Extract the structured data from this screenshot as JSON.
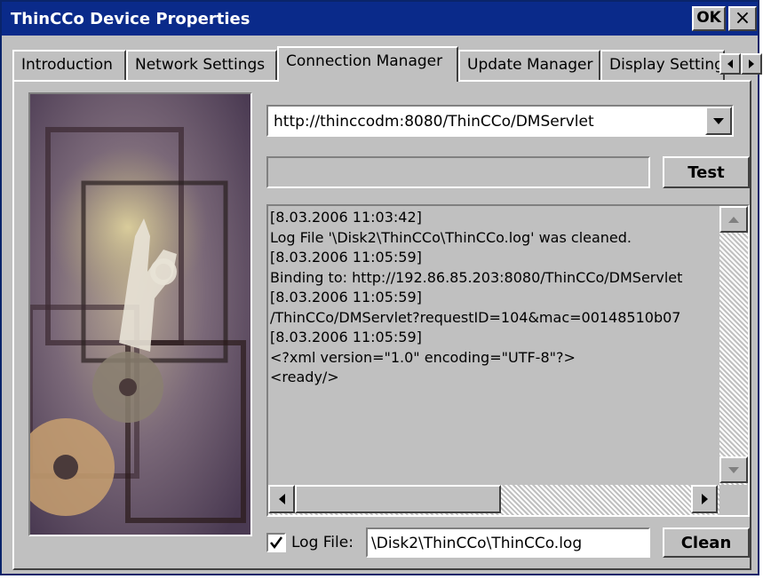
{
  "window": {
    "title": "ThinCCo Device Properties",
    "ok_label": "OK",
    "close_label": "×"
  },
  "tabs": [
    {
      "label": "Introduction"
    },
    {
      "label": "Network Settings"
    },
    {
      "label": "Connection Manager"
    },
    {
      "label": "Update Manager"
    },
    {
      "label": "Display Settings"
    }
  ],
  "active_tab": "Connection Manager",
  "connection": {
    "url_value": "http://thinccodm:8080/ThinCCo/DMServlet",
    "status_value": "",
    "test_label": "Test"
  },
  "log": {
    "lines": [
      "[8.03.2006 11:03:42]",
      "Log File '\\Disk2\\ThinCCo\\ThinCCo.log' was cleaned.",
      "[8.03.2006 11:05:59]",
      "Binding to: http://192.86.85.203:8080/ThinCCo/DMServlet",
      "[8.03.2006 11:05:59]",
      "/ThinCCo/DMServlet?requestID=104&mac=00148510b07",
      "[8.03.2006 11:05:59]",
      "<?xml version=\"1.0\" encoding=\"UTF-8\"?>",
      "<ready/>"
    ]
  },
  "logfile": {
    "checked": true,
    "label": "Log File:",
    "path_value": "\\Disk2\\ThinCCo\\ThinCCo.log",
    "clean_label": "Clean"
  },
  "colors": {
    "titlebar": "#0a2a8a",
    "face": "#c0c0c0"
  }
}
